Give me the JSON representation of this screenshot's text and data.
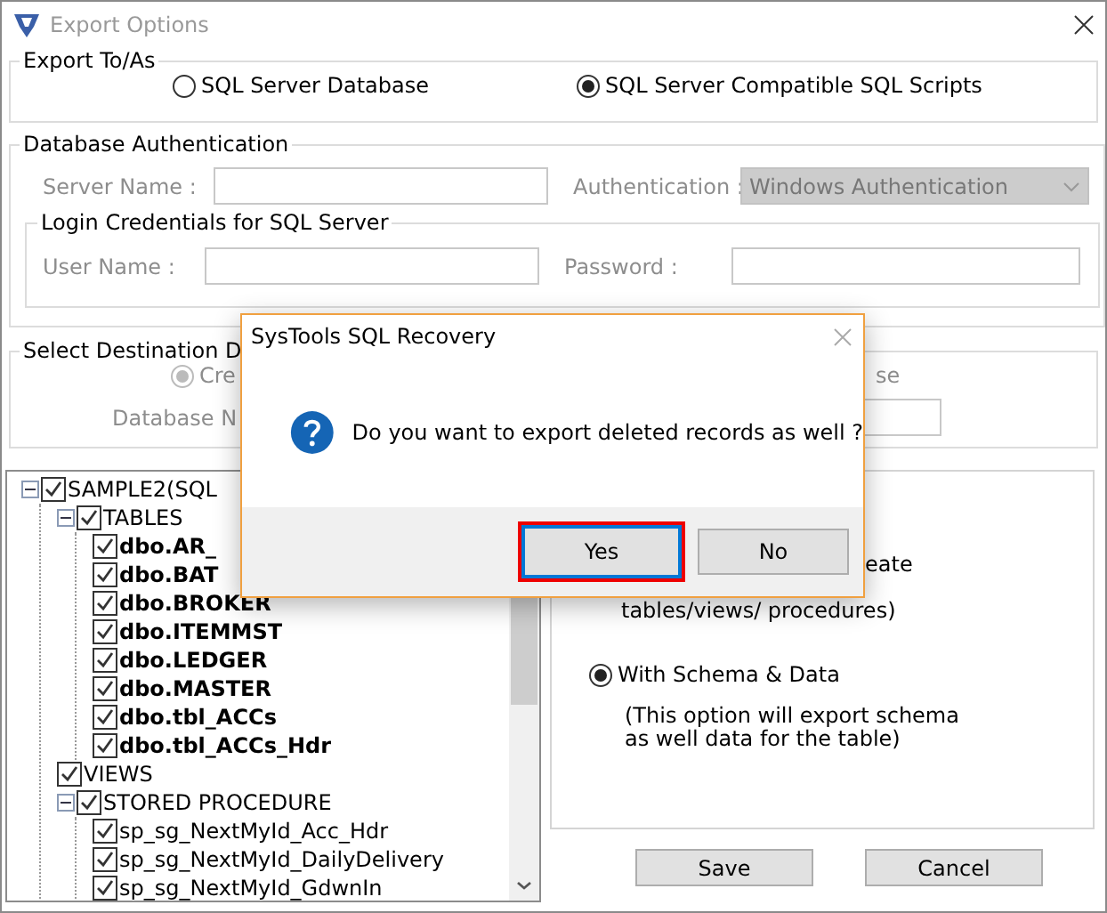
{
  "window": {
    "title": "Export Options"
  },
  "export_to": {
    "legend": "Export To/As",
    "options": [
      {
        "label": "SQL Server Database",
        "selected": false
      },
      {
        "label": "SQL Server Compatible SQL Scripts",
        "selected": true
      }
    ]
  },
  "database_authentication": {
    "legend": "Database Authentication",
    "disabled": true,
    "server_name_label": "Server Name :",
    "authentication_label": "Authentication :",
    "authentication_value": "Windows Authentication",
    "login_credentials": {
      "legend": "Login Credentials for SQL Server",
      "user_name_label": "User Name :",
      "password_label": "Password :"
    }
  },
  "destination": {
    "legend": "Select Destination D",
    "disabled": true,
    "option": {
      "label": "Cre",
      "selected": true
    },
    "trailing_text": "se",
    "database_name_label": "Database N"
  },
  "tree": [
    {
      "label": "SAMPLE2(SQL",
      "checked": true,
      "expanded": true,
      "children": [
        {
          "label": "TABLES",
          "checked": true,
          "expanded": true,
          "children": [
            {
              "label": "dbo.AR_",
              "checked": true,
              "bold": true
            },
            {
              "label": "dbo.BAT",
              "checked": true,
              "bold": true
            },
            {
              "label": "dbo.BROKER",
              "checked": true,
              "bold": true
            },
            {
              "label": "dbo.ITEMMST",
              "checked": true,
              "bold": true
            },
            {
              "label": "dbo.LEDGER",
              "checked": true,
              "bold": true
            },
            {
              "label": "dbo.MASTER",
              "checked": true,
              "bold": true
            },
            {
              "label": "dbo.tbl_ACCs",
              "checked": true,
              "bold": true
            },
            {
              "label": "dbo.tbl_ACCs_Hdr",
              "checked": true,
              "bold": true
            }
          ]
        },
        {
          "label": "VIEWS",
          "checked": true
        },
        {
          "label": "STORED PROCEDURE",
          "checked": true,
          "expanded": true,
          "children": [
            {
              "label": "sp_sg_NextMyId_Acc_Hdr",
              "checked": true
            },
            {
              "label": "sp_sg_NextMyId_DailyDelivery",
              "checked": true
            },
            {
              "label": "sp_sg_NextMyId_GdwnIn",
              "checked": true
            }
          ]
        }
      ]
    }
  ],
  "options_panel": {
    "partial_lines": [
      "eate"
    ],
    "schema_only_tail": "tables/views/ procedures)",
    "schema_option": {
      "label": "With Schema & Data",
      "selected": true
    },
    "schema_description": [
      "(This option will export schema",
      "as well data for the table)"
    ]
  },
  "buttons": [
    "Save",
    "Cancel"
  ],
  "dialog": {
    "title": "SysTools SQL Recovery",
    "message": "Do you want to export deleted records as well ?",
    "buttons": [
      {
        "label": "Yes",
        "focused": true
      },
      {
        "label": "No",
        "focused": false
      }
    ]
  }
}
